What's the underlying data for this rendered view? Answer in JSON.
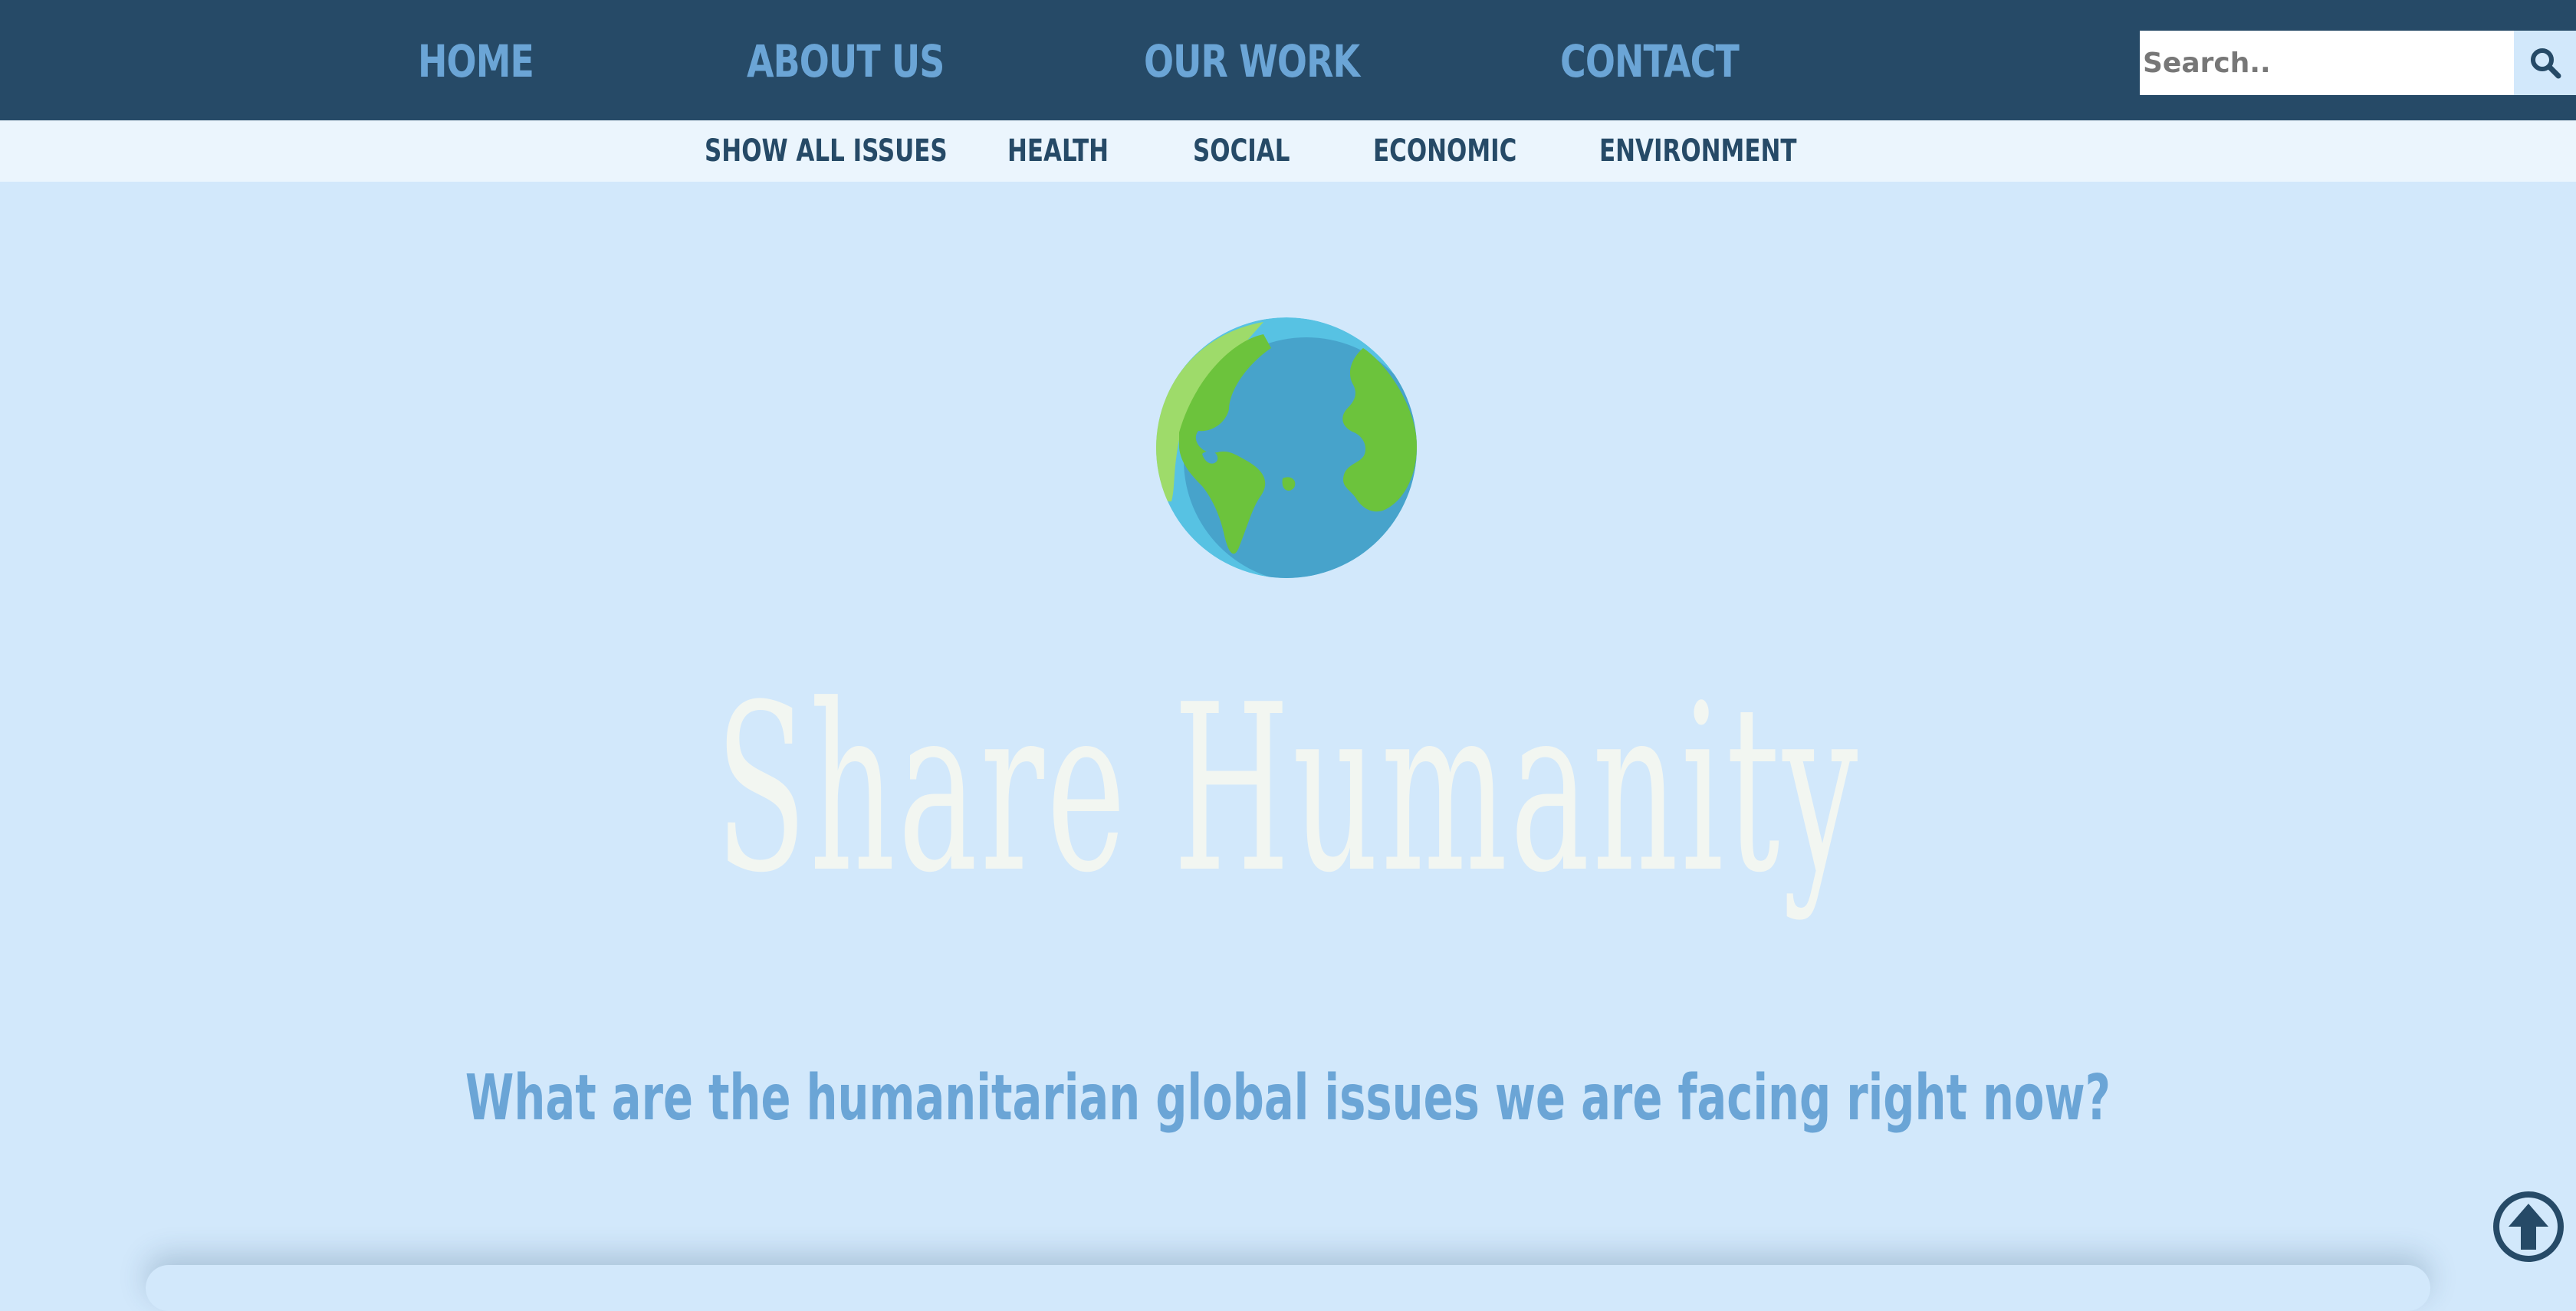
{
  "nav": {
    "items": [
      {
        "label": "HOME"
      },
      {
        "label": "ABOUT US"
      },
      {
        "label": "OUR WORK"
      },
      {
        "label": "CONTACT"
      }
    ],
    "search": {
      "placeholder": "Search..",
      "icon": "search-icon"
    }
  },
  "subnav": {
    "items": [
      {
        "label": "SHOW ALL ISSUES"
      },
      {
        "label": "HEALTH"
      },
      {
        "label": "SOCIAL"
      },
      {
        "label": "ECONOMIC"
      },
      {
        "label": "ENVIRONMENT"
      }
    ]
  },
  "hero": {
    "logo_icon": "globe-icon",
    "title": "Share Humanity",
    "subtitle": "What are the humanitarian global issues we are facing right now?"
  },
  "back_to_top": {
    "icon": "arrow-up-icon"
  },
  "colors": {
    "nav_background": "#264a67",
    "nav_link": "#6ba5d6",
    "subnav_background": "#ebf5fd",
    "page_background": "#d2e8fb",
    "title": "#f2f6f1",
    "subtitle": "#6ba5d6"
  }
}
